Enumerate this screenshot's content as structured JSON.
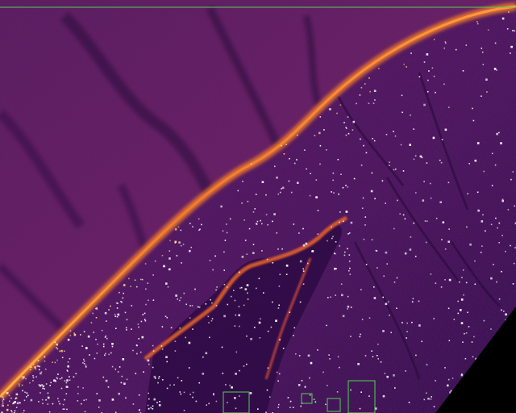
{
  "image": {
    "kind": "thermal false-color aerial view of a snow-covered mountain ridge",
    "palette": {
      "cold": "#2a0a3e",
      "cool": "#4a1252",
      "mid": "#6e1d5c",
      "warm": "#b8366a",
      "hot": "#f07a2a",
      "hottest": "#ffd070",
      "speckle": "#ffffff",
      "void": "#000000"
    },
    "overlay": {
      "horizon_line_color": "#4cd44c",
      "box_color": "#4cd44c",
      "detection_boxes": 4
    }
  }
}
